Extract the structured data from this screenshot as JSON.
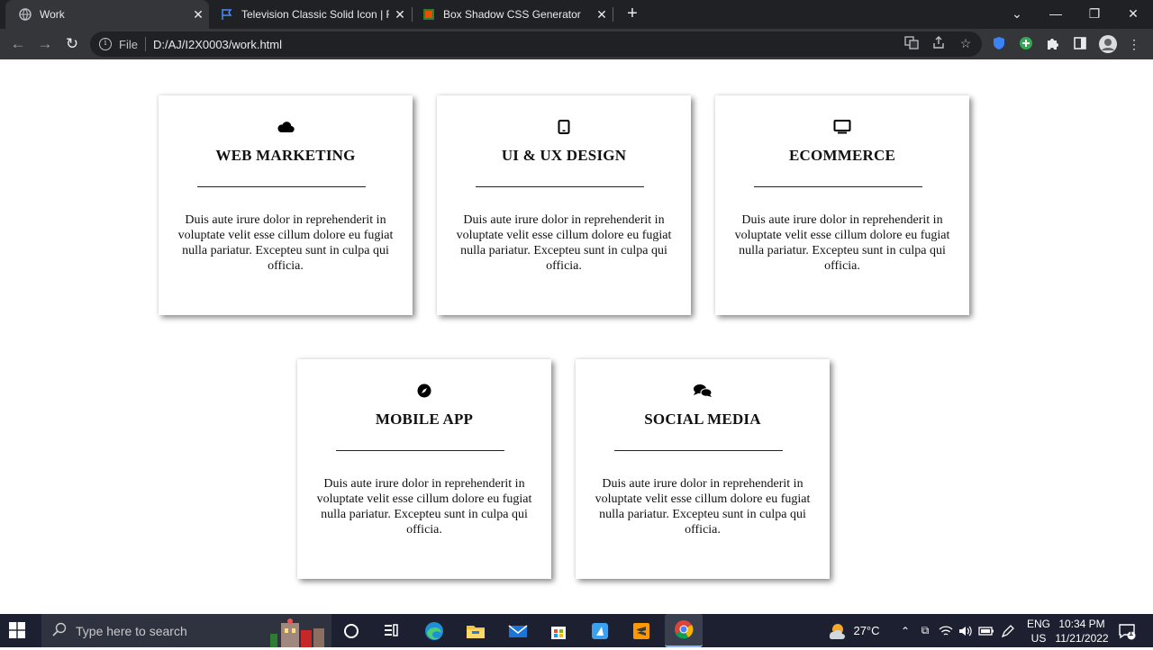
{
  "browser": {
    "tabs": [
      {
        "title": "Work",
        "active": true
      },
      {
        "title": "Television Classic Solid Icon | Fon",
        "active": false
      },
      {
        "title": "Box Shadow CSS Generator",
        "active": false
      }
    ],
    "new_tab": "+",
    "window_controls": {
      "dropdown": "⌄",
      "minimize": "—",
      "restore": "❐",
      "close": "✕"
    },
    "address": {
      "scheme_label": "File",
      "url": "D:/AJ/I2X0003/work.html"
    }
  },
  "cards": [
    {
      "icon": "cloud-icon",
      "title": "WEB MARKETING",
      "text": "Duis aute irure dolor in reprehenderit in voluptate velit esse cillum dolore eu fugiat nulla pariatur. Excepteu sunt in culpa qui officia."
    },
    {
      "icon": "tablet-icon",
      "title": "UI & UX DESIGN",
      "text": "Duis aute irure dolor in reprehenderit in voluptate velit esse cillum dolore eu fugiat nulla pariatur. Excepteu sunt in culpa qui officia."
    },
    {
      "icon": "television-icon",
      "title": "ECOMMERCE",
      "text": "Duis aute irure dolor in reprehenderit in voluptate velit esse cillum dolore eu fugiat nulla pariatur. Excepteu sunt in culpa qui officia."
    },
    {
      "icon": "compass-icon",
      "title": "MOBILE APP",
      "text": "Duis aute irure dolor in reprehenderit in voluptate velit esse cillum dolore eu fugiat nulla pariatur. Excepteu sunt in culpa qui officia."
    },
    {
      "icon": "comments-icon",
      "title": "SOCIAL MEDIA",
      "text": "Duis aute irure dolor in reprehenderit in voluptate velit esse cillum dolore eu fugiat nulla pariatur. Excepteu sunt in culpa qui officia."
    }
  ],
  "taskbar": {
    "search_placeholder": "Type here to search",
    "weather": "27°C",
    "language": "ENG",
    "region": "US",
    "time": "10:34 PM",
    "date": "11/21/2022",
    "notification_count": "1"
  }
}
